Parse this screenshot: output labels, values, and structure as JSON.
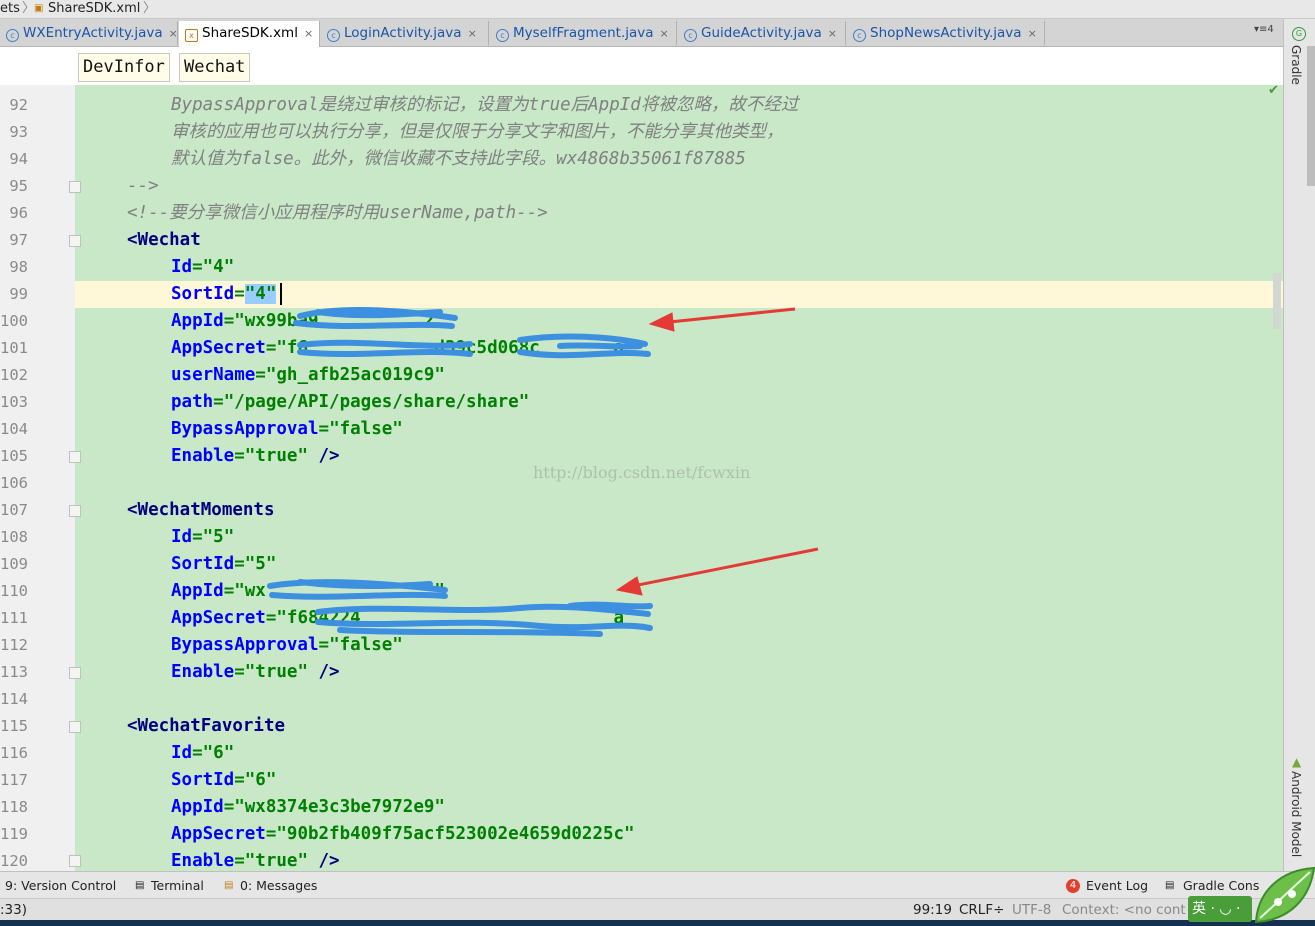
{
  "breadcrumb": {
    "prev": "ets",
    "file": "ShareSDK.xml"
  },
  "tabs": [
    {
      "label": "WXEntryActivity.java",
      "close": "×"
    },
    {
      "label": "ShareSDK.xml",
      "close": "×"
    },
    {
      "label": "LoginActivity.java",
      "close": "×"
    },
    {
      "label": "MyselfFragment.java",
      "close": "×"
    },
    {
      "label": "GuideActivity.java",
      "close": "×"
    },
    {
      "label": "ShopNewsActivity.java",
      "close": "×"
    }
  ],
  "tab_menu": "▾≡4",
  "xml_breadcrumb": [
    "DevInfor",
    "Wechat"
  ],
  "lines": [
    {
      "n": "92",
      "t": "BypassApproval是绕过审核的标记，设置为true后AppId将被忽略，故不经过"
    },
    {
      "n": "93",
      "t": "审核的应用也可以执行分享，但是仅限于分享文字和图片，不能分享其他类型，"
    },
    {
      "n": "94",
      "t": "默认值为false。此外，微信收藏不支持此字段。wx4868b35061f87885"
    },
    {
      "n": "95",
      "t": "-->"
    },
    {
      "n": "96",
      "t": "<!--要分享微信小应用程序时用userName,path-->"
    },
    {
      "n": "97",
      "t": "<Wechat"
    },
    {
      "n": "98",
      "a": "Id",
      "v": "\"4\""
    },
    {
      "n": "99",
      "a": "SortId",
      "v": "\"4\""
    },
    {
      "n": "100",
      "a": "AppId",
      "v": "\"wx99ba9          2\""
    },
    {
      "n": "101",
      "a": "AppSecret",
      "v": "\"f6            d39c5d068c       a\""
    },
    {
      "n": "102",
      "a": "userName",
      "v": "\"gh_afb25ac019c9\""
    },
    {
      "n": "103",
      "a": "path",
      "v": "\"/page/API/pages/share/share\""
    },
    {
      "n": "104",
      "a": "BypassApproval",
      "v": "\"false\""
    },
    {
      "n": "105",
      "a": "Enable",
      "v": "\"true\"",
      "end": " />"
    },
    {
      "n": "106"
    },
    {
      "n": "107",
      "t": "<WechatMoments"
    },
    {
      "n": "108",
      "a": "Id",
      "v": "\"5\""
    },
    {
      "n": "109",
      "a": "SortId",
      "v": "\"5\""
    },
    {
      "n": "110",
      "a": "AppId",
      "v": "\"wx                \""
    },
    {
      "n": "111",
      "a": "AppSecret",
      "v": "\"f684224                        a\""
    },
    {
      "n": "112",
      "a": "BypassApproval",
      "v": "\"false\""
    },
    {
      "n": "113",
      "a": "Enable",
      "v": "\"true\"",
      "end": " />"
    },
    {
      "n": "114"
    },
    {
      "n": "115",
      "t": "<WechatFavorite"
    },
    {
      "n": "116",
      "a": "Id",
      "v": "\"6\""
    },
    {
      "n": "117",
      "a": "SortId",
      "v": "\"6\""
    },
    {
      "n": "118",
      "a": "AppId",
      "v": "\"wx8374e3c3be7972e9\""
    },
    {
      "n": "119",
      "a": "AppSecret",
      "v": "\"90b2fb409f75acf523002e4659d0225c\""
    },
    {
      "n": "120",
      "a": "Enable",
      "v": "\"true\"",
      "end": " />"
    }
  ],
  "watermark": "http://blog.csdn.net/fcwxin",
  "right_tools": [
    "Gradle",
    "Android Model"
  ],
  "bottom_tools": {
    "version_control": "9: Version Control",
    "terminal": "Terminal",
    "messages": "0: Messages",
    "event_log": "Event Log",
    "event_log_badge": "4",
    "gradle_console": "Gradle Cons"
  },
  "status": {
    "left": ":33)",
    "position": "99:19",
    "line_sep": "CRLF÷",
    "encoding": "UTF-8",
    "context": "Context: <no cont"
  },
  "ime": "英 · ◡ ·",
  "colors": {
    "code_bg": "#c8e8c8",
    "current_line": "#fff8d8",
    "tag": "#000080",
    "attr": "#0000ff",
    "value": "#008000",
    "comment": "#808080",
    "redact": "#3d8fe0",
    "arrow": "#e53935"
  }
}
